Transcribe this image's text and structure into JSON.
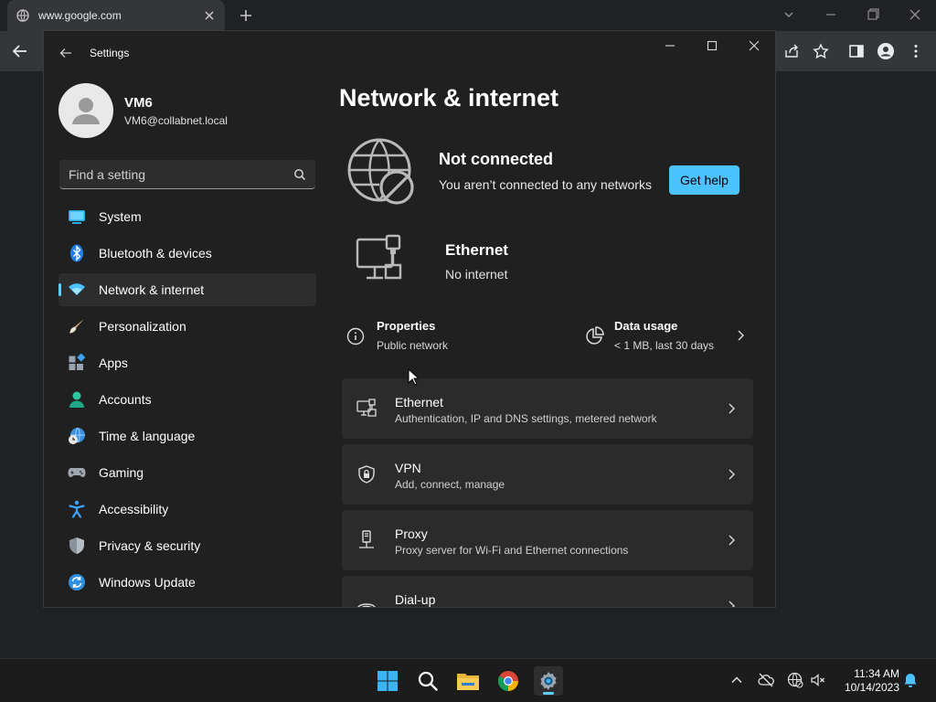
{
  "chrome": {
    "tab_title": "www.google.com"
  },
  "settings": {
    "window_title": "Settings",
    "profile": {
      "name": "VM6",
      "email": "VM6@collabnet.local"
    },
    "search": {
      "placeholder": "Find a setting"
    },
    "nav": [
      {
        "label": "System",
        "icon": "system-icon"
      },
      {
        "label": "Bluetooth & devices",
        "icon": "bluetooth-icon"
      },
      {
        "label": "Network & internet",
        "icon": "wifi-icon",
        "active": true
      },
      {
        "label": "Personalization",
        "icon": "brush-icon"
      },
      {
        "label": "Apps",
        "icon": "apps-icon"
      },
      {
        "label": "Accounts",
        "icon": "accounts-icon"
      },
      {
        "label": "Time & language",
        "icon": "globe-clock-icon"
      },
      {
        "label": "Gaming",
        "icon": "gamepad-icon"
      },
      {
        "label": "Accessibility",
        "icon": "accessibility-icon"
      },
      {
        "label": "Privacy & security",
        "icon": "shield-icon"
      },
      {
        "label": "Windows Update",
        "icon": "update-icon"
      }
    ],
    "page_title": "Network & internet",
    "status": {
      "title": "Not connected",
      "subtitle": "You aren’t connected to any networks",
      "help_button": "Get help"
    },
    "ethernet_summary": {
      "title": "Ethernet",
      "subtitle": "No internet"
    },
    "properties": {
      "title": "Properties",
      "subtitle": "Public network"
    },
    "data_usage": {
      "title": "Data usage",
      "subtitle": "< 1 MB, last 30 days"
    },
    "cards": [
      {
        "title": "Ethernet",
        "subtitle": "Authentication, IP and DNS settings, metered network",
        "icon": "ethernet-icon"
      },
      {
        "title": "VPN",
        "subtitle": "Add, connect, manage",
        "icon": "vpn-shield-icon"
      },
      {
        "title": "Proxy",
        "subtitle": "Proxy server for Wi-Fi and Ethernet connections",
        "icon": "proxy-icon"
      },
      {
        "title": "Dial-up",
        "subtitle": "",
        "icon": "dialup-icon"
      }
    ]
  },
  "taskbar": {
    "time": "11:34 AM",
    "date": "10/14/2023"
  },
  "colors": {
    "accent": "#60cdff",
    "button": "#4cc2ff",
    "window_bg": "#202020",
    "card_bg": "#2b2b2b"
  }
}
